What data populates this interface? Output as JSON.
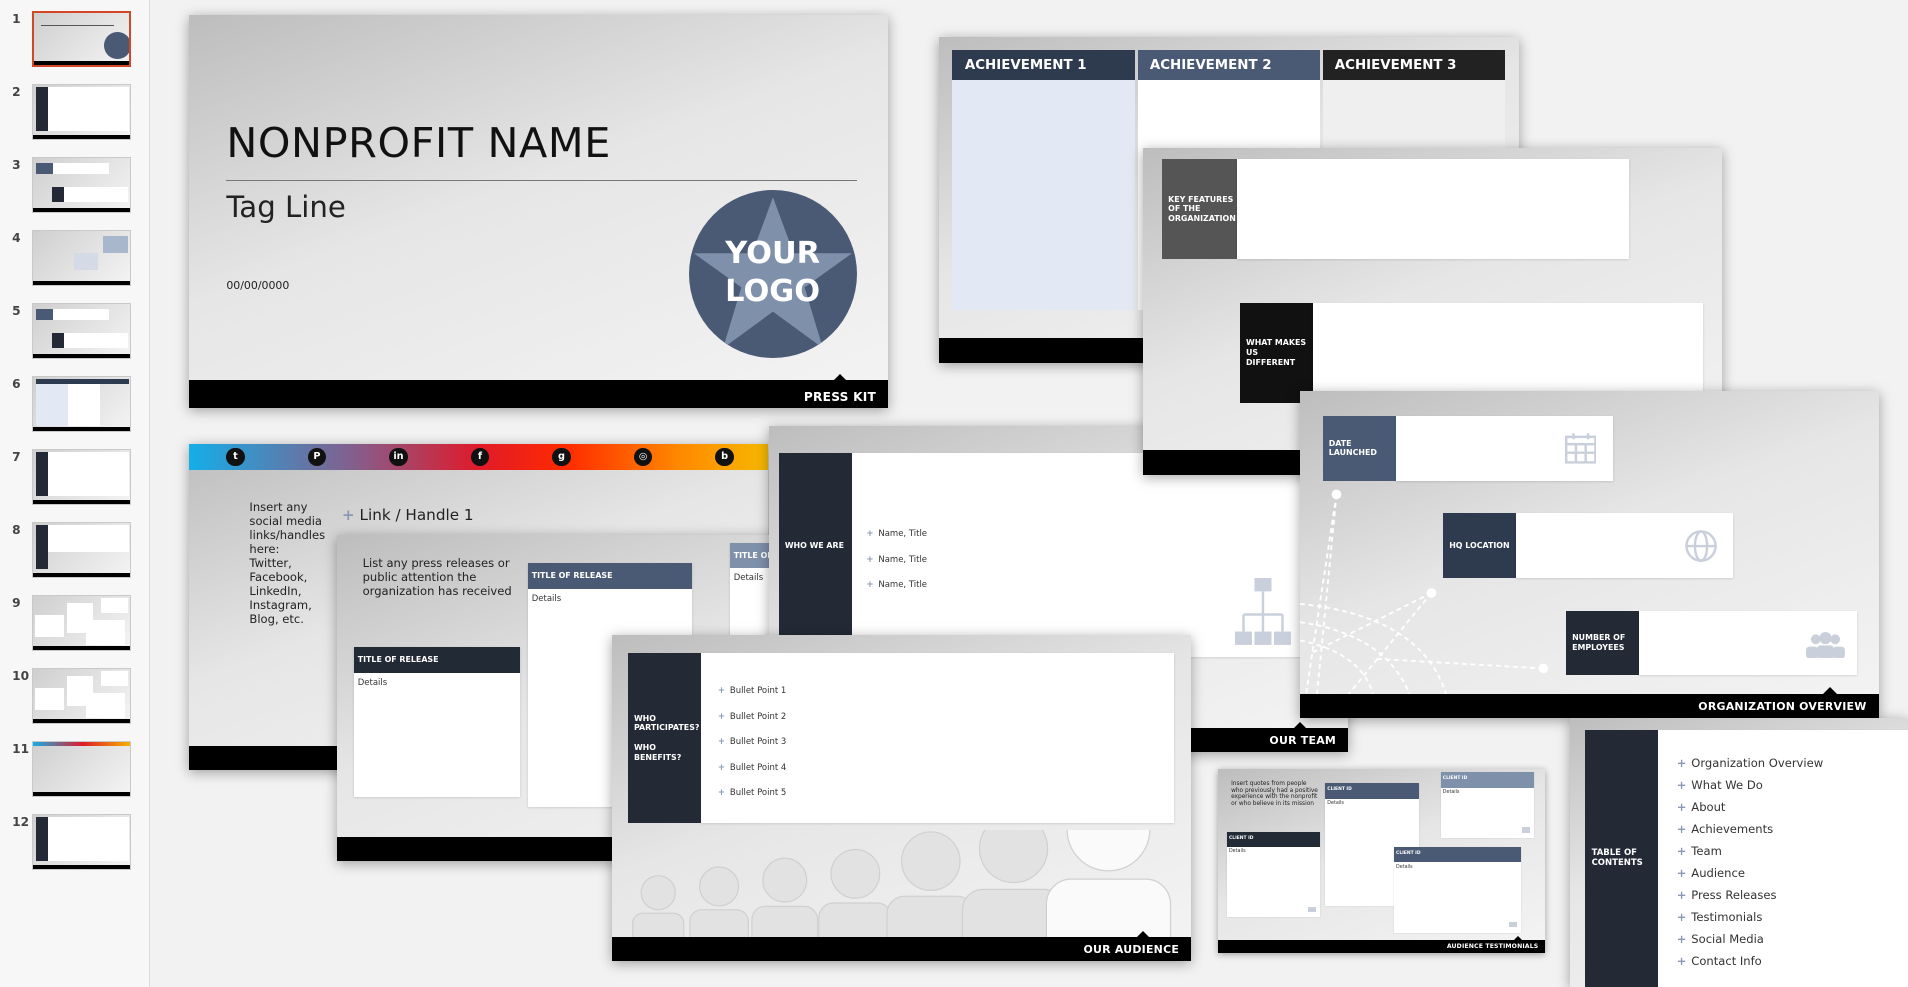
{
  "thumbnails": {
    "numbers": [
      "1",
      "2",
      "3",
      "4",
      "5",
      "6",
      "7",
      "8",
      "9",
      "10",
      "11",
      "12"
    ],
    "selected": "1"
  },
  "colors": {
    "navy": "#232a36",
    "slate": "#4a5a75",
    "steel": "#7f90ab",
    "select": "#d24726"
  },
  "title_slide": {
    "title": "NONPROFIT NAME",
    "tagline": "Tag Line",
    "date": "00/00/0000",
    "logo_line1": "YOUR",
    "logo_line2": "LOGO",
    "footer": "PRESS KIT"
  },
  "achievements": {
    "columns": [
      "ACHIEVEMENT 1",
      "ACHIEVEMENT 2",
      "ACHIEVEMENT 3"
    ]
  },
  "features": {
    "box1": "KEY FEATURES OF THE ORGANIZATION",
    "box2": "WHAT MAKES US DIFFERENT"
  },
  "social": {
    "icons": [
      "twitter-icon",
      "pinterest-icon",
      "linkedin-icon",
      "facebook-icon",
      "google-plus-icon",
      "instagram-icon",
      "blogger-icon"
    ],
    "intro": "Insert any social media links/handles here: Twitter, Facebook, LinkedIn, Instagram, Blog, etc.",
    "link1": "Link / Handle 1"
  },
  "press": {
    "intro": "List any press releases or public attention the organization has received",
    "box_title": "TITLE OF RELEASE",
    "box_title_clipped": "TITLE OF",
    "details": "Details"
  },
  "team": {
    "panel": "WHO WE ARE",
    "members": [
      "Name, Title",
      "Name, Title",
      "Name, Title"
    ],
    "footer": "OUR TEAM"
  },
  "overview": {
    "date": "DATE LAUNCHED",
    "hq": "HQ LOCATION",
    "employees": "NUMBER OF EMPLOYEES",
    "footer": "ORGANIZATION OVERVIEW"
  },
  "audience": {
    "panel1": "WHO PARTICIPATES?",
    "panel2": "WHO BENEFITS?",
    "bullets": [
      "Bullet Point 1",
      "Bullet Point 2",
      "Bullet Point 3",
      "Bullet Point 4",
      "Bullet Point 5"
    ],
    "footer": "OUR AUDIENCE"
  },
  "testimonials": {
    "intro": "Insert quotes from people who previously had a positive experience with the nonprofit or who believe in its mission",
    "client": "CLIENT ID",
    "details": "Details",
    "footer": "AUDIENCE TESTIMONIALS"
  },
  "toc": {
    "panel": "TABLE OF CONTENTS",
    "items": [
      "Organization Overview",
      "What We Do",
      "About",
      "Achievements",
      "Team",
      "Audience",
      "Press Releases",
      "Testimonials",
      "Social Media",
      "Contact Info"
    ]
  }
}
